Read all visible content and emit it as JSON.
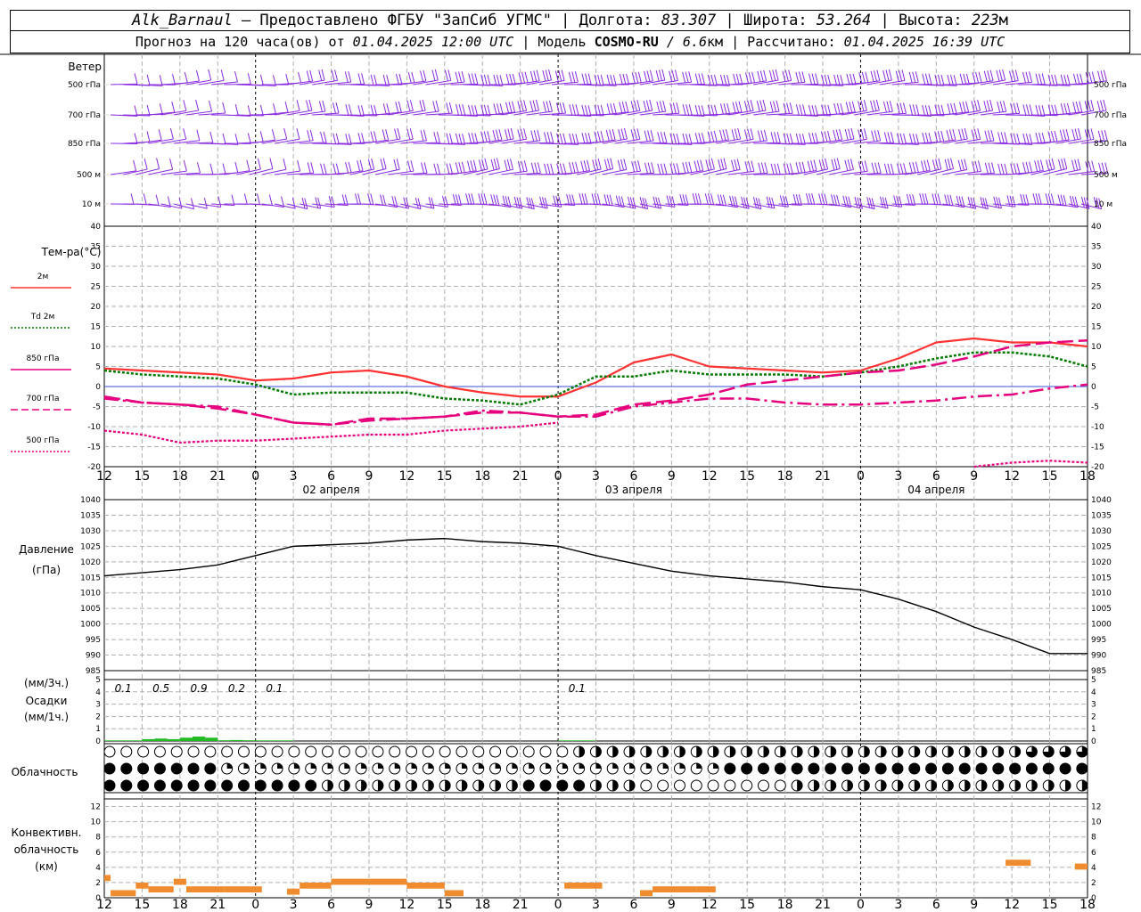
{
  "header": {
    "station": "Alk_Barnaul",
    "provided": "— Предоставлено ФГБУ \"ЗапСиб УГМС\" |",
    "lon_label": "Долгота:",
    "lon": "83.307",
    "lat_label": "| Широта:",
    "lat": "53.264",
    "alt_label": "| Высота:",
    "alt": "223",
    "alt_unit": "м",
    "forecast_prefix": "Прогноз на 120 часа(ов) от",
    "forecast_time": "01.04.2025 12:00 UTC",
    "model_label": "| Модель",
    "model": "COSMO-RU",
    "model_res": "/ 6.6",
    "model_res_unit": "км",
    "calc_label": "| Рассчитано:",
    "calc_time": "01.04.2025 16:39 UTC"
  },
  "wind_panel": {
    "title": "Ветер",
    "levels": [
      "500 гПа",
      "700 гПа",
      "850 гПа",
      "500 м",
      "10 м"
    ],
    "barb_color": "#8a2be2"
  },
  "temp_panel": {
    "title": "Тем-ра(°С)",
    "legend": [
      {
        "label": "2м",
        "color": "#ff3333",
        "style": "solid"
      },
      {
        "label": "Td 2м",
        "color": "#007a00",
        "style": "dotted"
      },
      {
        "label": "850 гПа",
        "color": "#e6007e",
        "style": "solid"
      },
      {
        "label": "700 гПа",
        "color": "#e6007e",
        "style": "dashed"
      },
      {
        "label": "500 гПа",
        "color": "#e6007e",
        "style": "dotted"
      }
    ],
    "y_ticks": [
      "40",
      "35",
      "30",
      "25",
      "20",
      "15",
      "10",
      "5",
      "0",
      "-5",
      "-10",
      "-15",
      "-20"
    ]
  },
  "pressure_panel": {
    "title": "Давление",
    "unit": "(гПа)",
    "y_ticks": [
      "1040",
      "1035",
      "1030",
      "1025",
      "1020",
      "1015",
      "1010",
      "1005",
      "1000",
      "995",
      "990",
      "985"
    ]
  },
  "precip_panel": {
    "unit_top": "(мм/3ч.)",
    "title": "Осадки",
    "unit_bottom": "(мм/1ч.)",
    "y_ticks": [
      "5",
      "4",
      "3",
      "2",
      "1",
      "0"
    ],
    "amounts": [
      "0.1",
      "0.5",
      "0.9",
      "0.2",
      "0.1",
      "0.1"
    ]
  },
  "cloud_panel": {
    "title": "Облачность"
  },
  "conv_panel": {
    "title_1": "Конвективн.",
    "title_2": "облачность",
    "unit": "(км)",
    "y_ticks": [
      "12",
      "10",
      "8",
      "6",
      "4",
      "2",
      "0"
    ]
  },
  "x_axis": {
    "hour_labels": [
      "12",
      "15",
      "18",
      "21",
      "0",
      "3",
      "6",
      "9",
      "12",
      "15",
      "18",
      "21",
      "0",
      "3",
      "6",
      "9",
      "12",
      "15",
      "18",
      "21",
      "0",
      "3",
      "6",
      "9",
      "12",
      "15",
      "18"
    ],
    "date_labels": [
      "02 апреля",
      "03 апреля",
      "04 апреля"
    ]
  },
  "chart_data": {
    "type": "line",
    "x_hours_from_start": [
      0,
      3,
      6,
      9,
      12,
      15,
      18,
      21,
      24,
      27,
      30,
      33,
      36,
      39,
      42,
      45,
      48,
      51,
      54,
      57,
      60,
      63,
      66,
      69,
      72,
      75,
      78
    ],
    "series": [
      {
        "name": "2м",
        "unit": "°C",
        "values": [
          4.5,
          4.0,
          3.5,
          3.0,
          1.5,
          2.0,
          3.5,
          4.0,
          2.5,
          0.0,
          -1.5,
          -2.5,
          -2.5,
          1.0,
          6.0,
          8.0,
          5.0,
          4.5,
          4.0,
          3.5,
          4.0,
          7.0,
          11.0,
          12.0,
          11.0,
          11.0,
          10.0
        ]
      },
      {
        "name": "Td 2м",
        "unit": "°C",
        "values": [
          4.0,
          3.0,
          2.5,
          2.0,
          0.5,
          -2.0,
          -1.5,
          -1.5,
          -1.5,
          -3.0,
          -3.5,
          -4.5,
          -2.0,
          2.5,
          2.5,
          4.0,
          3.0,
          3.0,
          3.0,
          2.5,
          3.5,
          5.0,
          7.0,
          8.5,
          8.5,
          7.5,
          5.0
        ]
      },
      {
        "name": "850 гПа",
        "unit": "°C",
        "values": [
          -2.5,
          -4.0,
          -4.5,
          -5.5,
          -7.0,
          -9.0,
          -9.5,
          -8.0,
          -8.0,
          -7.5,
          -6.5,
          -6.5,
          -7.5,
          -7.0,
          -4.5,
          -3.5,
          -2.0,
          0.5,
          1.5,
          2.5,
          3.5,
          4.0,
          5.5,
          7.5,
          10.0,
          11.0,
          11.5
        ]
      },
      {
        "name": "700 гПа",
        "unit": "°C",
        "values": [
          -3.0,
          -4.0,
          -4.5,
          -5.0,
          -7.0,
          -9.0,
          -9.5,
          -8.5,
          -8.0,
          -7.5,
          -6.0,
          -6.5,
          -7.5,
          -7.5,
          -5.0,
          -4.0,
          -3.0,
          -3.0,
          -4.0,
          -4.5,
          -4.5,
          -4.0,
          -3.5,
          -2.5,
          -2.0,
          -0.5,
          0.5
        ]
      },
      {
        "name": "500 гПа",
        "unit": "°C",
        "values": [
          -11.0,
          -12.0,
          -14.0,
          -13.5,
          -13.5,
          -13.0,
          -12.5,
          -12.0,
          -12.0,
          -11.0,
          -10.5,
          -10.0,
          -9.0,
          null,
          null,
          null,
          null,
          null,
          null,
          null,
          null,
          null,
          null,
          -20.0,
          -19.0,
          -18.5,
          -19.0
        ]
      },
      {
        "name": "Давление",
        "unit": "гПа",
        "values": [
          1015.5,
          1016.5,
          1017.5,
          1019.0,
          1022.0,
          1025.0,
          1025.5,
          1026.0,
          1027.0,
          1027.5,
          1026.5,
          1026.0,
          1025.0,
          1022.0,
          1019.5,
          1017.0,
          1015.5,
          1014.5,
          1013.5,
          1012.0,
          1011.0,
          1008.0,
          1004.0,
          999.0,
          995.0,
          990.5,
          990.5
        ]
      }
    ],
    "precip_mm_3h": [
      {
        "hour": 0,
        "value": 0.1
      },
      {
        "hour": 3,
        "value": 0.5
      },
      {
        "hour": 6,
        "value": 0.9
      },
      {
        "hour": 9,
        "value": 0.2
      },
      {
        "hour": 12,
        "value": 0.1
      },
      {
        "hour": 36,
        "value": 0.1
      }
    ],
    "convective_km": [
      {
        "from": 0,
        "to": 0.5,
        "top": 3
      },
      {
        "from": 0.5,
        "to": 2.5,
        "top": 1
      },
      {
        "from": 2.5,
        "to": 3.5,
        "top": 2
      },
      {
        "from": 3.5,
        "to": 5.5,
        "top": 1.5
      },
      {
        "from": 5.5,
        "to": 6.5,
        "top": 2.5
      },
      {
        "from": 6.5,
        "to": 9.5,
        "top": 1.5
      },
      {
        "from": 9.5,
        "to": 12.5,
        "top": 1.5
      },
      {
        "from": 14.5,
        "to": 15.5,
        "top": 1.2
      },
      {
        "from": 15.5,
        "to": 18,
        "top": 2
      },
      {
        "from": 18,
        "to": 21,
        "top": 2.5
      },
      {
        "from": 21,
        "to": 24,
        "top": 2.5
      },
      {
        "from": 24,
        "to": 27,
        "top": 2
      },
      {
        "from": 27,
        "to": 28.5,
        "top": 1
      },
      {
        "from": 36.5,
        "to": 39.5,
        "top": 2
      },
      {
        "from": 42.5,
        "to": 43.5,
        "top": 1
      },
      {
        "from": 43.5,
        "to": 47,
        "top": 1.5
      },
      {
        "from": 47,
        "to": 48.5,
        "top": 1.5
      },
      {
        "from": 71.5,
        "to": 73.5,
        "top": 5
      },
      {
        "from": 77,
        "to": 78,
        "top": 4.5
      }
    ]
  }
}
